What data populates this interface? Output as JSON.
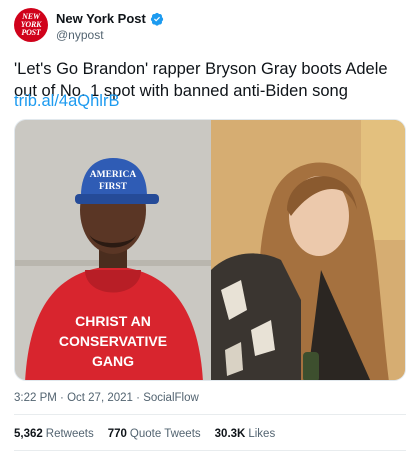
{
  "account": {
    "avatar_text": [
      "NEW",
      "YORK",
      "POST"
    ],
    "display_name": "New York Post",
    "handle": "@nypost",
    "verified_icon": "verified-badge-icon"
  },
  "tweet": {
    "text": "'Let's Go Brandon' rapper Bryson Gray boots Adele out of No. 1 spot with banned anti-Biden song",
    "link": "trib.al/4aQhlrB"
  },
  "media": {
    "left_image": {
      "hat_text_line1": "AMERICA",
      "hat_text_line2": "FIRST",
      "shirt_line1": "CHRIST AN",
      "shirt_line2": "CONSERVATIVE",
      "shirt_line3": "GANG"
    },
    "right_image": {}
  },
  "meta": {
    "time": "3:22 PM",
    "separator": "·",
    "date": "Oct 27, 2021",
    "source": "SocialFlow"
  },
  "stats": {
    "retweets_count": "5,362",
    "retweets_label": "Retweets",
    "quotes_count": "770",
    "quotes_label": "Quote Tweets",
    "likes_count": "30.3K",
    "likes_label": "Likes"
  },
  "colors": {
    "brand_red": "#d0021b",
    "link_blue": "#1d9bf0",
    "verified_blue": "#1d9bf0"
  }
}
